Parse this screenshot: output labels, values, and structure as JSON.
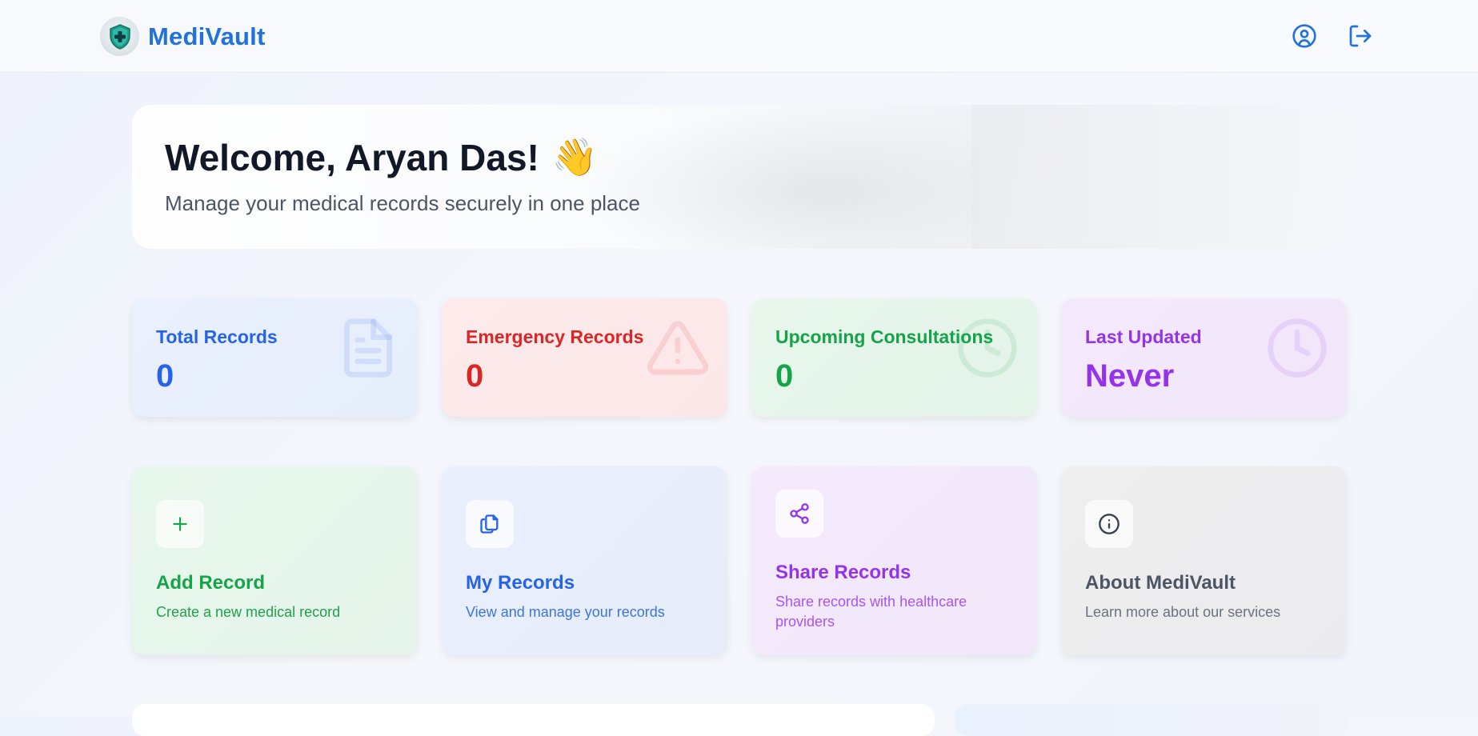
{
  "header": {
    "brand_name": "MediVault",
    "logo_icon": "shield-cross-logo",
    "profile_icon": "user-circle-icon",
    "logout_icon": "logout-icon"
  },
  "welcome": {
    "title": "Welcome, Aryan Das!",
    "emoji": "👋",
    "subtitle": "Manage your medical records securely in one place"
  },
  "stats": [
    {
      "label": "Total Records",
      "value": "0",
      "icon": "document-icon",
      "color": "#2563eb"
    },
    {
      "label": "Emergency Records",
      "value": "0",
      "icon": "warning-triangle-icon",
      "color": "#dc2626"
    },
    {
      "label": "Upcoming Consultations",
      "value": "0",
      "icon": "clock-icon",
      "color": "#16a34a"
    },
    {
      "label": "Last Updated",
      "value": "Never",
      "icon": "clock-icon",
      "color": "#9333ea"
    }
  ],
  "actions": [
    {
      "title": "Add Record",
      "description": "Create a new medical record",
      "icon": "plus-icon",
      "color": "#16a34a"
    },
    {
      "title": "My Records",
      "description": "View and manage your records",
      "icon": "copy-documents-icon",
      "color": "#2563eb"
    },
    {
      "title": "Share Records",
      "description": "Share records with healthcare providers",
      "icon": "share-icon",
      "color": "#9333ea"
    },
    {
      "title": "About MediVault",
      "description": "Learn more about our services",
      "icon": "info-icon",
      "color": "#4b5563"
    }
  ]
}
